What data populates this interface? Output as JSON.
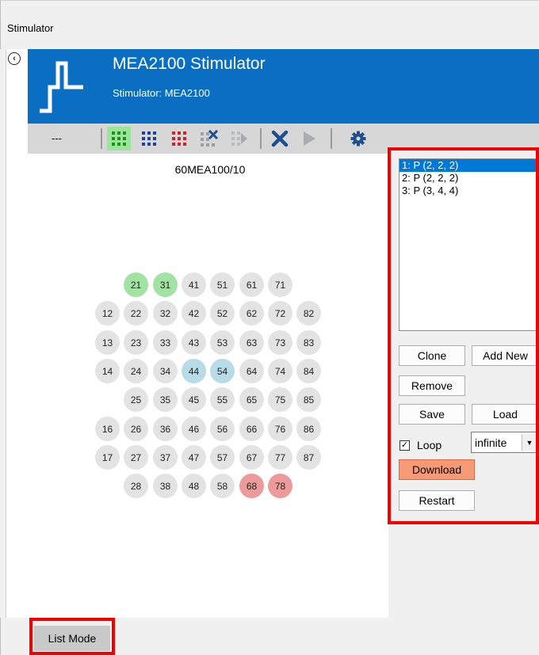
{
  "window": {
    "title": "Stimulator"
  },
  "header": {
    "app_title": "MEA2100 Stimulator",
    "subtitle": "Stimulator:  MEA2100",
    "brand_color": "#0a6fc2"
  },
  "toolbar": {
    "dash_label": "---",
    "buttons": [
      {
        "icon": "grid-green-icon",
        "active": true
      },
      {
        "icon": "grid-blue-icon",
        "active": false
      },
      {
        "icon": "grid-red-icon",
        "active": false
      },
      {
        "icon": "grid-clear-icon",
        "active": false
      },
      {
        "icon": "grid-play-icon",
        "active": false
      },
      {
        "icon": "stop-x-icon",
        "active": false
      },
      {
        "icon": "play-icon",
        "active": false
      },
      {
        "icon": "gear-icon",
        "active": false
      }
    ]
  },
  "layout": {
    "name": "60MEA100/10",
    "electrodes": [
      [
        "",
        "21",
        "31",
        "41",
        "51",
        "61",
        "71",
        ""
      ],
      [
        "12",
        "22",
        "32",
        "42",
        "52",
        "62",
        "72",
        "82"
      ],
      [
        "13",
        "23",
        "33",
        "43",
        "53",
        "63",
        "73",
        "83"
      ],
      [
        "14",
        "24",
        "34",
        "44",
        "54",
        "64",
        "74",
        "84"
      ],
      [
        "",
        "25",
        "35",
        "45",
        "55",
        "65",
        "75",
        "85"
      ],
      [
        "16",
        "26",
        "36",
        "46",
        "56",
        "66",
        "76",
        "86"
      ],
      [
        "17",
        "27",
        "37",
        "47",
        "57",
        "67",
        "77",
        "87"
      ],
      [
        "",
        "28",
        "38",
        "48",
        "58",
        "68",
        "78",
        ""
      ]
    ],
    "green": [
      "21",
      "31"
    ],
    "blue": [
      "44",
      "54"
    ],
    "red": [
      "68",
      "78"
    ],
    "colors": {
      "default": "#e3e3e3",
      "green": "#a2e2a2",
      "blue": "#b8dbe8",
      "red": "#ed9a9a"
    }
  },
  "patterns": {
    "items": [
      "1: P (2, 2, 2)",
      "2: P (2, 2, 2)",
      "3: P (3, 4, 4)"
    ],
    "selected_index": 0
  },
  "buttons": {
    "clone": "Clone",
    "add_new": "Add New",
    "remove": "Remove",
    "save": "Save",
    "load": "Load",
    "download": "Download",
    "restart": "Restart"
  },
  "loop": {
    "label": "Loop",
    "checked": true,
    "mode": "infinite"
  },
  "footer": {
    "list_mode": "List Mode"
  },
  "highlight_color": "#f40000"
}
